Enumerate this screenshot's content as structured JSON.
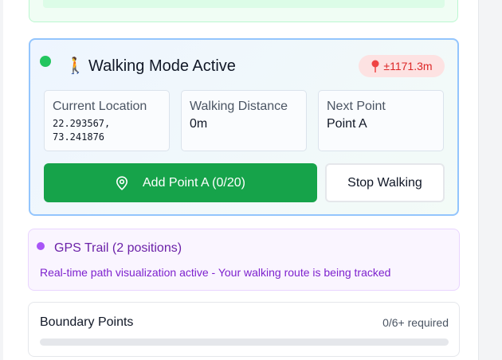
{
  "walking_card": {
    "title": "Walking Mode Active",
    "icon": "walking-person-icon",
    "accuracy_badge": "±1171.3m",
    "current_location": {
      "label": "Current Location",
      "lat": "22.293567,",
      "lng": "73.241876"
    },
    "walking_distance": {
      "label": "Walking Distance",
      "value": "0m"
    },
    "next_point": {
      "label": "Next Point",
      "value": "Point A"
    },
    "add_point_button": "Add Point A (0/20)",
    "stop_button": "Stop Walking"
  },
  "gps_trail": {
    "title": "GPS Trail (2 positions)",
    "description": "Real-time path visualization active - Your walking route is being tracked"
  },
  "boundary": {
    "title": "Boundary Points",
    "requirement": "0/6+ required",
    "progress_fraction": 0
  },
  "colors": {
    "accent_green": "#16a34a",
    "status_green": "#22c55e",
    "badge_red": "#dc2626",
    "border_blue": "#93c5fd",
    "purple": "#a855f7"
  }
}
